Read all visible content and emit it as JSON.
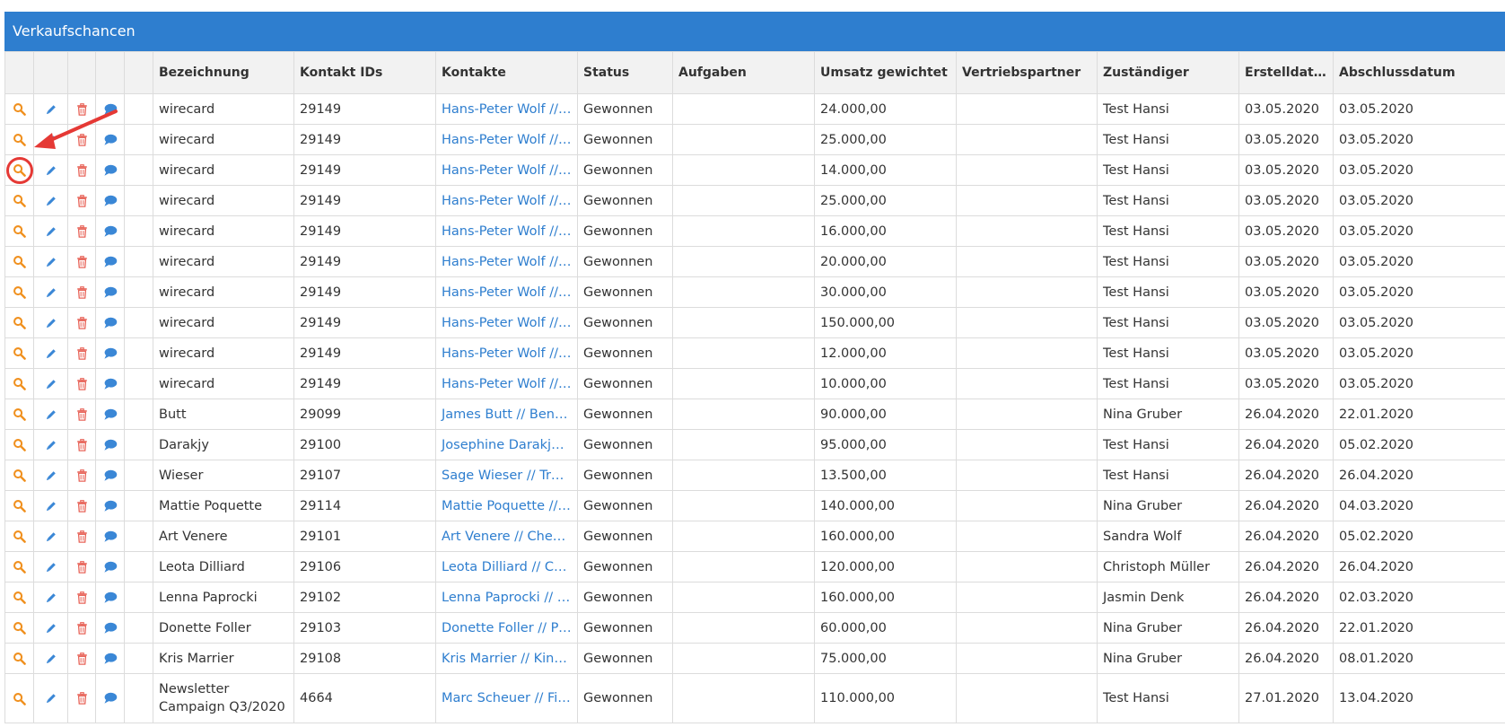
{
  "panel": {
    "title": "Verkaufschancen"
  },
  "columns": [
    "",
    "",
    "",
    "",
    "",
    "Bezeichnung",
    "Kontakt IDs",
    "Kontakte",
    "Status",
    "Aufgaben",
    "Umsatz gewichtet",
    "Vertriebspartner",
    "Zuständiger",
    "Erstelldatum",
    "Abschlussdatum"
  ],
  "rows": [
    {
      "bezeichnung": "wirecard",
      "kontakt_ids": "29149",
      "kontakte": "Hans-Peter Wolf // Firma",
      "status": "Gewonnen",
      "aufgaben": "",
      "umsatz": "24.000,00",
      "vertriebspartner": "",
      "zustaendiger": "Test Hansi",
      "erstelldatum": "03.05.2020",
      "abschlussdatum": "03.05.2020"
    },
    {
      "bezeichnung": "wirecard",
      "kontakt_ids": "29149",
      "kontakte": "Hans-Peter Wolf // Firma",
      "status": "Gewonnen",
      "aufgaben": "",
      "umsatz": "25.000,00",
      "vertriebspartner": "",
      "zustaendiger": "Test Hansi",
      "erstelldatum": "03.05.2020",
      "abschlussdatum": "03.05.2020"
    },
    {
      "bezeichnung": "wirecard",
      "kontakt_ids": "29149",
      "kontakte": "Hans-Peter Wolf // Firma",
      "status": "Gewonnen",
      "aufgaben": "",
      "umsatz": "14.000,00",
      "vertriebspartner": "",
      "zustaendiger": "Test Hansi",
      "erstelldatum": "03.05.2020",
      "abschlussdatum": "03.05.2020"
    },
    {
      "bezeichnung": "wirecard",
      "kontakt_ids": "29149",
      "kontakte": "Hans-Peter Wolf // Firma",
      "status": "Gewonnen",
      "aufgaben": "",
      "umsatz": "25.000,00",
      "vertriebspartner": "",
      "zustaendiger": "Test Hansi",
      "erstelldatum": "03.05.2020",
      "abschlussdatum": "03.05.2020"
    },
    {
      "bezeichnung": "wirecard",
      "kontakt_ids": "29149",
      "kontakte": "Hans-Peter Wolf // Firma",
      "status": "Gewonnen",
      "aufgaben": "",
      "umsatz": "16.000,00",
      "vertriebspartner": "",
      "zustaendiger": "Test Hansi",
      "erstelldatum": "03.05.2020",
      "abschlussdatum": "03.05.2020"
    },
    {
      "bezeichnung": "wirecard",
      "kontakt_ids": "29149",
      "kontakte": "Hans-Peter Wolf // Firma",
      "status": "Gewonnen",
      "aufgaben": "",
      "umsatz": "20.000,00",
      "vertriebspartner": "",
      "zustaendiger": "Test Hansi",
      "erstelldatum": "03.05.2020",
      "abschlussdatum": "03.05.2020"
    },
    {
      "bezeichnung": "wirecard",
      "kontakt_ids": "29149",
      "kontakte": "Hans-Peter Wolf // Firma",
      "status": "Gewonnen",
      "aufgaben": "",
      "umsatz": "30.000,00",
      "vertriebspartner": "",
      "zustaendiger": "Test Hansi",
      "erstelldatum": "03.05.2020",
      "abschlussdatum": "03.05.2020"
    },
    {
      "bezeichnung": "wirecard",
      "kontakt_ids": "29149",
      "kontakte": "Hans-Peter Wolf // Firma",
      "status": "Gewonnen",
      "aufgaben": "",
      "umsatz": "150.000,00",
      "vertriebspartner": "",
      "zustaendiger": "Test Hansi",
      "erstelldatum": "03.05.2020",
      "abschlussdatum": "03.05.2020"
    },
    {
      "bezeichnung": "wirecard",
      "kontakt_ids": "29149",
      "kontakte": "Hans-Peter Wolf // Firma",
      "status": "Gewonnen",
      "aufgaben": "",
      "umsatz": "12.000,00",
      "vertriebspartner": "",
      "zustaendiger": "Test Hansi",
      "erstelldatum": "03.05.2020",
      "abschlussdatum": "03.05.2020"
    },
    {
      "bezeichnung": "wirecard",
      "kontakt_ids": "29149",
      "kontakte": "Hans-Peter Wolf // Firma",
      "status": "Gewonnen",
      "aufgaben": "",
      "umsatz": "10.000,00",
      "vertriebspartner": "",
      "zustaendiger": "Test Hansi",
      "erstelldatum": "03.05.2020",
      "abschlussdatum": "03.05.2020"
    },
    {
      "bezeichnung": "Butt",
      "kontakt_ids": "29099",
      "kontakte": "James Butt // Benton, John B Jr",
      "status": "Gewonnen",
      "aufgaben": "",
      "umsatz": "90.000,00",
      "vertriebspartner": "",
      "zustaendiger": "Nina Gruber",
      "erstelldatum": "26.04.2020",
      "abschlussdatum": "22.01.2020"
    },
    {
      "bezeichnung": "Darakjy",
      "kontakt_ids": "29100",
      "kontakte": "Josephine Darakjy // Chanay",
      "status": "Gewonnen",
      "aufgaben": "",
      "umsatz": "95.000,00",
      "vertriebspartner": "",
      "zustaendiger": "Test Hansi",
      "erstelldatum": "26.04.2020",
      "abschlussdatum": "05.02.2020"
    },
    {
      "bezeichnung": "Wieser",
      "kontakt_ids": "29107",
      "kontakte": "Sage Wieser // Truhlar And",
      "status": "Gewonnen",
      "aufgaben": "",
      "umsatz": "13.500,00",
      "vertriebspartner": "",
      "zustaendiger": "Test Hansi",
      "erstelldatum": "26.04.2020",
      "abschlussdatum": "26.04.2020"
    },
    {
      "bezeichnung": "Mattie Poquette",
      "kontakt_ids": "29114",
      "kontakte": "Mattie Poquette // Century",
      "status": "Gewonnen",
      "aufgaben": "",
      "umsatz": "140.000,00",
      "vertriebspartner": "",
      "zustaendiger": "Nina Gruber",
      "erstelldatum": "26.04.2020",
      "abschlussdatum": "04.03.2020"
    },
    {
      "bezeichnung": "Art Venere",
      "kontakt_ids": "29101",
      "kontakte": "Art Venere // Chemel, James",
      "status": "Gewonnen",
      "aufgaben": "",
      "umsatz": "160.000,00",
      "vertriebspartner": "",
      "zustaendiger": "Sandra Wolf",
      "erstelldatum": "26.04.2020",
      "abschlussdatum": "05.02.2020"
    },
    {
      "bezeichnung": "Leota Dilliard",
      "kontakt_ids": "29106",
      "kontakte": "Leota Dilliard // Commercial",
      "status": "Gewonnen",
      "aufgaben": "",
      "umsatz": "120.000,00",
      "vertriebspartner": "",
      "zustaendiger": "Christoph Müller",
      "erstelldatum": "26.04.2020",
      "abschlussdatum": "26.04.2020"
    },
    {
      "bezeichnung": "Lenna Paprocki",
      "kontakt_ids": "29102",
      "kontakte": "Lenna Paprocki // Feltz",
      "status": "Gewonnen",
      "aufgaben": "",
      "umsatz": "160.000,00",
      "vertriebspartner": "",
      "zustaendiger": "Jasmin Denk",
      "erstelldatum": "26.04.2020",
      "abschlussdatum": "02.03.2020"
    },
    {
      "bezeichnung": "Donette Foller",
      "kontakt_ids": "29103",
      "kontakte": "Donette Foller // Printing",
      "status": "Gewonnen",
      "aufgaben": "",
      "umsatz": "60.000,00",
      "vertriebspartner": "",
      "zustaendiger": "Nina Gruber",
      "erstelldatum": "26.04.2020",
      "abschlussdatum": "22.01.2020"
    },
    {
      "bezeichnung": "Kris Marrier",
      "kontakt_ids": "29108",
      "kontakte": "Kris Marrier // King, Christopher",
      "status": "Gewonnen",
      "aufgaben": "",
      "umsatz": "75.000,00",
      "vertriebspartner": "",
      "zustaendiger": "Nina Gruber",
      "erstelldatum": "26.04.2020",
      "abschlussdatum": "08.01.2020"
    },
    {
      "bezeichnung": "Newsletter Campaign Q3/2020",
      "kontakt_ids": "4664",
      "kontakte": "Marc Scheuer // First Hill",
      "status": "Gewonnen",
      "aufgaben": "",
      "umsatz": "110.000,00",
      "vertriebspartner": "",
      "zustaendiger": "Test Hansi",
      "erstelldatum": "27.01.2020",
      "abschlussdatum": "13.04.2020"
    }
  ],
  "icons": {
    "view": "magnifier-icon",
    "edit": "pencil-icon",
    "delete": "trash-icon",
    "comment": "speech-bubble-icon"
  },
  "colors": {
    "header": "#2e7ecf",
    "link": "#2e7ecf",
    "view_icon": "#f0901e",
    "edit_icon": "#3a87d6",
    "delete_icon": "#e8655a",
    "comment_icon": "#3a87d6",
    "annotation": "#e53935"
  }
}
